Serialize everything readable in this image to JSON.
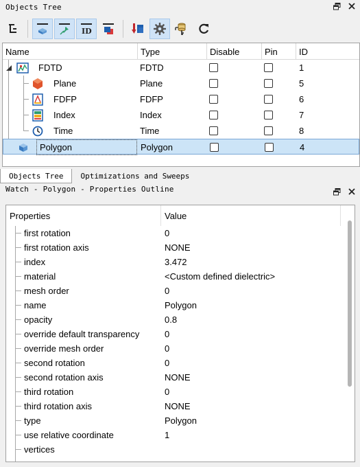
{
  "objects_panel": {
    "title": "Objects Tree",
    "columns": [
      "Name",
      "Type",
      "Disable",
      "Pin",
      "ID"
    ],
    "rows": [
      {
        "name": "FDTD",
        "type": "FDTD",
        "id": "1",
        "icon": "fdtd-icon",
        "expand": "▲"
      },
      {
        "name": "Plane",
        "type": "Plane",
        "id": "5",
        "icon": "plane-source-icon"
      },
      {
        "name": "FDFP",
        "type": "FDFP",
        "id": "6",
        "icon": "fdfp-monitor-icon"
      },
      {
        "name": "Index",
        "type": "Index",
        "id": "7",
        "icon": "index-monitor-icon"
      },
      {
        "name": "Time",
        "type": "Time",
        "id": "8",
        "icon": "time-monitor-icon"
      },
      {
        "name": "Polygon",
        "type": "Polygon",
        "id": "4",
        "icon": "polygon-structure-icon",
        "selected": true
      }
    ]
  },
  "tabs": [
    "Objects Tree",
    "Optimizations and Sweeps"
  ],
  "properties_panel": {
    "title": "Watch - Polygon - Properties Outline",
    "columns": [
      "Properties",
      "Value"
    ],
    "rows": [
      {
        "name": "first rotation",
        "value": "0"
      },
      {
        "name": "first rotation axis",
        "value": "NONE"
      },
      {
        "name": "index",
        "value": "3.472"
      },
      {
        "name": "material",
        "value": "<Custom defined dielectric>"
      },
      {
        "name": "mesh order",
        "value": "0"
      },
      {
        "name": "name",
        "value": "Polygon"
      },
      {
        "name": "opacity",
        "value": "0.8"
      },
      {
        "name": "override default transparency",
        "value": "0"
      },
      {
        "name": "override mesh order",
        "value": "0"
      },
      {
        "name": "second rotation",
        "value": "0"
      },
      {
        "name": "second rotation axis",
        "value": "NONE"
      },
      {
        "name": "third rotation",
        "value": "0"
      },
      {
        "name": "third rotation axis",
        "value": "NONE"
      },
      {
        "name": "type",
        "value": "Polygon"
      },
      {
        "name": "use relative coordinate",
        "value": "1"
      },
      {
        "name": "vertices",
        "value": ""
      }
    ]
  },
  "colors": {
    "selection": "#cce4f7",
    "pressed": "#cfe3f7"
  }
}
